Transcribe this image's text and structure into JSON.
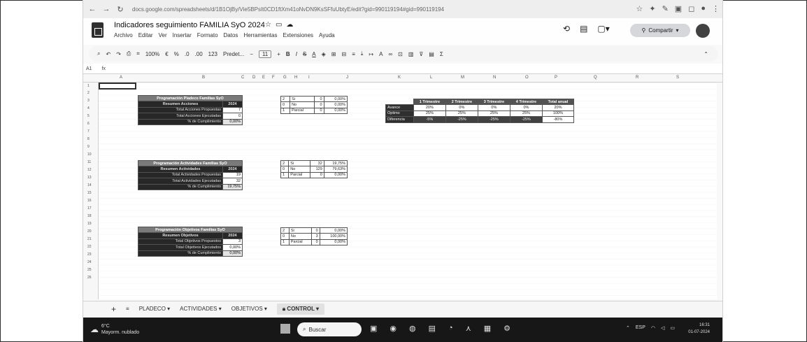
{
  "browser": {
    "url": "docs.google.com/spreadsheets/d/1B1OjBy/Vie5BPsIt0CD1ftXm41oNvDN9KsSFfuUbtyE/edit?gid=990119194#gid=990119194",
    "nav_icons": [
      "back-icon",
      "forward-icon",
      "reload-icon"
    ]
  },
  "document": {
    "title": "Indicadores seguimiento FAMILIA SyO 2024",
    "menus": [
      "Archivo",
      "Editar",
      "Ver",
      "Insertar",
      "Formato",
      "Datos",
      "Herramientas",
      "Extensiones",
      "Ayuda"
    ],
    "share_label": "Compartir"
  },
  "toolbar": {
    "zoom": "100%",
    "currency": "€",
    "percent": "%",
    "dec_less": ".0",
    "dec_more": ".00",
    "number_format": "123",
    "font": "Predet...",
    "font_size": "11"
  },
  "formula_bar": {
    "cell_ref": "A1",
    "fx": "fx"
  },
  "columns": [
    "A",
    "B",
    "C",
    "D",
    "E",
    "F",
    "G",
    "H",
    "I",
    "J",
    "K",
    "L",
    "M",
    "N",
    "O",
    "P",
    "Q",
    "R",
    "S"
  ],
  "rows": [
    "1",
    "2",
    "3",
    "4",
    "5",
    "6",
    "7",
    "8",
    "9",
    "10",
    "11",
    "12",
    "13",
    "14",
    "15",
    "16",
    "17",
    "18",
    "19",
    "20",
    "21",
    "22",
    "23",
    "24",
    "25",
    "26"
  ],
  "acciones": {
    "title": "Programación Pladeco Familias SyO",
    "header": "Resumen Acciones",
    "year": "2024",
    "rows": [
      {
        "label": "Total Acciones Propuestas",
        "value": "7"
      },
      {
        "label": "Total Acciones Ejecutadas",
        "value": "0"
      },
      {
        "label": "% de Cumplimiento",
        "value": "0,00%"
      }
    ],
    "tally": [
      {
        "code": "2",
        "label": "Si",
        "count": "0",
        "pct": "0,00%"
      },
      {
        "code": "0",
        "label": "No",
        "count": "0",
        "pct": "0,00%"
      },
      {
        "code": "1",
        "label": "Parcial",
        "count": "0",
        "pct": "0,00%"
      }
    ]
  },
  "actividades": {
    "title": "Programación Actividades Familias SyO",
    "header": "Resumen Actividades",
    "year": "2024",
    "rows": [
      {
        "label": "Total Actividades Propuestas",
        "value": "19"
      },
      {
        "label": "Total Actividades Ejecutadas",
        "value": "32"
      },
      {
        "label": "% de Cumplimiento",
        "value": "19,75%"
      }
    ],
    "tally": [
      {
        "code": "2",
        "label": "Si",
        "count": "32",
        "pct": "19,75%"
      },
      {
        "code": "0",
        "label": "No",
        "count": "129",
        "pct": "79,63%"
      },
      {
        "code": "1",
        "label": "Parcial",
        "count": "0",
        "pct": "0,00%"
      }
    ]
  },
  "objetivos": {
    "title": "Programación Objetivos Familias SyO",
    "header": "Resumen Objetivos",
    "year": "2024",
    "rows": [
      {
        "label": "Total Objetivos Propuestos",
        "value": "3"
      },
      {
        "label": "Total Objetivos Ejecutados",
        "value": "0,00%"
      },
      {
        "label": "% de Cumplimiento",
        "value": "0,00%"
      }
    ],
    "tally": [
      {
        "code": "2",
        "label": "Si",
        "count": "0",
        "pct": "0,00%"
      },
      {
        "code": "0",
        "label": "No",
        "count": "3",
        "pct": "100,00%"
      },
      {
        "code": "1",
        "label": "Parcial",
        "count": "0",
        "pct": "0,00%"
      }
    ]
  },
  "trimestres": {
    "headers": [
      "1 Trimestre",
      "2 Trimestre",
      "3 Trimestre",
      "4 Trimestre",
      "Total anual"
    ],
    "rows": [
      {
        "label": "Avance",
        "values": [
          "20%",
          "0%",
          "0%",
          "0%",
          "20%"
        ]
      },
      {
        "label": "Óptimo",
        "values": [
          "25%",
          "25%",
          "25%",
          "25%",
          "100%"
        ]
      },
      {
        "label": "Diferencia",
        "values": [
          "-5%",
          "-25%",
          "-25%",
          "-25%",
          "-80%"
        ]
      }
    ]
  },
  "sheet_tabs": [
    "PLADECO",
    "ACTIVIDADES",
    "OBJETIVOS",
    "CONTROL"
  ],
  "active_tab": "CONTROL",
  "taskbar": {
    "temperature": "6°C",
    "weather_text": "Mayorm. nublado",
    "search_placeholder": "Buscar",
    "lang": "ESP",
    "time": "16:31",
    "date": "01-07-2024"
  }
}
